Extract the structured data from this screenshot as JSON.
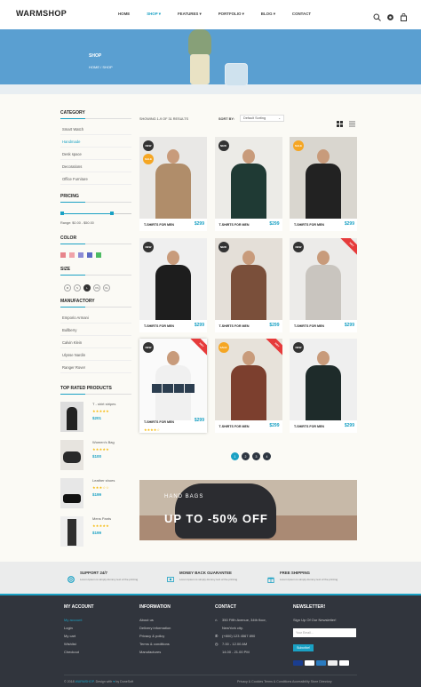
{
  "header": {
    "logo": "WARMSHOP",
    "nav": [
      "HOME",
      "SHOP ▾",
      "FEATURES ▾",
      "PORTFOLIO ▾",
      "BLOG ▾",
      "CONTACT"
    ],
    "icons": [
      "search-icon",
      "gear-icon",
      "cart-icon"
    ]
  },
  "hero": {
    "title": "SHOP",
    "breadcrumb": "HOME / SHOP"
  },
  "sidebar": {
    "category_title": "CATEGORY",
    "categories": [
      "Smart Watch",
      "Handmade",
      "Desk space",
      "Decorations",
      "Office Furniture"
    ],
    "pricing_title": "PRICING",
    "price_range": "Range: $0.00 - $50.00",
    "price_slider": {
      "min_fraction": 0.0,
      "max_fraction": 0.72
    },
    "color_title": "COLOR",
    "colors": [
      "#e7848b",
      "#f0a3a9",
      "#8b8bd6",
      "#5b6bc4",
      "#4dbb63"
    ],
    "size_title": "SIZE",
    "sizes": [
      "M",
      "S",
      "L",
      "XS",
      "XL"
    ],
    "manufactory_title": "MANUFACTORY",
    "manufactories": [
      "Emporio Armani",
      "Bullberry",
      "Calvin Klein",
      "Ulysse Nardin",
      "Ranger Rover"
    ],
    "top_rated_title": "TOP RATED PRODUCTS",
    "top_rated": [
      {
        "name": "T - shirt stripes",
        "stars": "★★★★★",
        "price": "$201"
      },
      {
        "name": "Women's Bag",
        "stars": "★★★★★",
        "price": "$100"
      },
      {
        "name": "Leather shoes",
        "stars": "★★★☆☆",
        "price": "$199"
      },
      {
        "name": "Mens Pants",
        "stars": "★★★★★",
        "price": "$199"
      }
    ]
  },
  "toolbar": {
    "count": "SHOWING 1-9 OF 31 RESULTS",
    "sort_label": "SORT BY:",
    "sort_value": "Default Sorting"
  },
  "products": [
    {
      "caption": "T-SHIRTS FOR MEN",
      "price": "$299",
      "new": "NEW",
      "sale": "SALE",
      "ribbon": "",
      "shirt": "#b08d6a",
      "bg": "#e9e8e6"
    },
    {
      "caption": "T-SHIRTS FOR MEN",
      "price": "$299",
      "new": "NEW",
      "sale": "",
      "ribbon": "",
      "shirt": "#1f3a34",
      "bg": "#ecebe7"
    },
    {
      "caption": "T-SHIRTS FOR MEN",
      "price": "$299",
      "new": "",
      "sale": "SALE",
      "ribbon": "",
      "shirt": "#222",
      "bg": "#d9d6cf"
    },
    {
      "caption": "T-SHIRTS FOR MEN",
      "price": "$299",
      "new": "NEW",
      "sale": "",
      "ribbon": "",
      "shirt": "#1d1d1d",
      "bg": "#efefef"
    },
    {
      "caption": "T-SHIRTS FOR MEN",
      "price": "$299",
      "new": "NEW",
      "sale": "",
      "ribbon": "",
      "shirt": "#7a4f3a",
      "bg": "#e4dfd8"
    },
    {
      "caption": "T-SHIRTS FOR MEN",
      "price": "$299",
      "new": "NEW",
      "sale": "",
      "ribbon": "HOT",
      "shirt": "#c9c5bf",
      "bg": "#ecebe9"
    },
    {
      "caption": "T-SHIRTS FOR MEN",
      "price": "$299",
      "new": "NEW",
      "sale": "",
      "ribbon": "HOT",
      "shirt": "#f0f0f0",
      "bg": "#fafafa",
      "stars": "★★★★☆",
      "hover": true
    },
    {
      "caption": "T-SHIRTS FOR MEN",
      "price": "$299",
      "new": "",
      "sale": "SALE",
      "ribbon": "HOT",
      "shirt": "#7c3f2e",
      "bg": "#e7e2da"
    },
    {
      "caption": "T-SHIRTS FOR MEN",
      "price": "$299",
      "new": "NEW",
      "sale": "",
      "ribbon": "",
      "shirt": "#1e2b2a",
      "bg": "#efefef"
    }
  ],
  "pagination": [
    "1",
    "2",
    "3",
    "4"
  ],
  "banner": {
    "label": "HAND BAGS",
    "headline": "UP TO -50% OFF"
  },
  "features": [
    {
      "icon": "lifebuoy-icon",
      "title": "SUPPORT 24/7",
      "sub": "Lorem Ipsum is simply dummy text of the printing"
    },
    {
      "icon": "money-icon",
      "title": "MONEY BACK GUARANTEE",
      "sub": "Lorem Ipsum is simply dummy text of the printing"
    },
    {
      "icon": "gift-icon",
      "title": "FREE SHIPPING",
      "sub": "Lorem Ipsum is simply dummy text of the printing"
    }
  ],
  "footer": {
    "account_title": "MY ACCOUNT",
    "account_links": [
      "My account",
      "Login",
      "My cart",
      "Wishlist",
      "Checkout"
    ],
    "info_title": "INFORMATION",
    "info_links": [
      "About us",
      "Delivery information",
      "Privacy & policy",
      "Terms & conditions",
      "Manufactures"
    ],
    "contact_title": "CONTACT",
    "contact_lines": [
      "350 Fifth Avenue, 34th floor,",
      "NewYork city.",
      "(+800) 123 4567 890",
      "7.00 - 12.00 AM",
      "14.00 - 21.00 PM"
    ],
    "newsletter_title": "NEWSLETTER!",
    "newsletter_text": "Sign Up Of Our Newsletter!",
    "newsletter_placeholder": "Your Email...",
    "subscribe": "Subcribe!",
    "copyright_pre": "© 2018",
    "copyright_brand": "WARMSHOP",
    "copyright_mid": ". Design with",
    "copyright_post": "by DuneSoft",
    "links": "Privacy & Cookies   Terms & Conditions   Accessibility   Store Directory"
  }
}
